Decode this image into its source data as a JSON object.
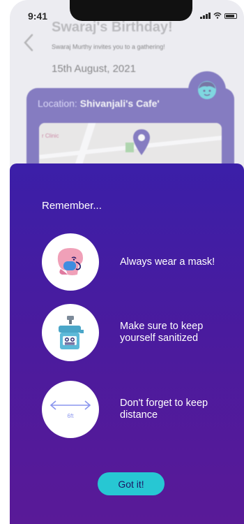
{
  "status_bar": {
    "time": "9:41"
  },
  "background_screen": {
    "title": "Swaraj's Birthday!",
    "invite_text": "Swaraj Murthy invites you to a gathering!",
    "date": "15th August, 2021",
    "location_label": "Location: ",
    "location_value": "Shivanjali's Cafe'",
    "map_label": "r Clinic"
  },
  "modal": {
    "heading": "Remember...",
    "tips": [
      {
        "icon": "mask-icon",
        "text": "Always wear a mask!"
      },
      {
        "icon": "sanitizer-icon",
        "text": "Make sure to keep yourself sanitized"
      },
      {
        "icon": "distance-icon",
        "text": "Don't forget to keep distance",
        "icon_label": "6ft"
      }
    ],
    "button_label": "Got it!"
  },
  "colors": {
    "sheet_top": "#3b1fa8",
    "sheet_bottom": "#5a1a97",
    "button": "#27c7d3",
    "card": "#31229a"
  }
}
